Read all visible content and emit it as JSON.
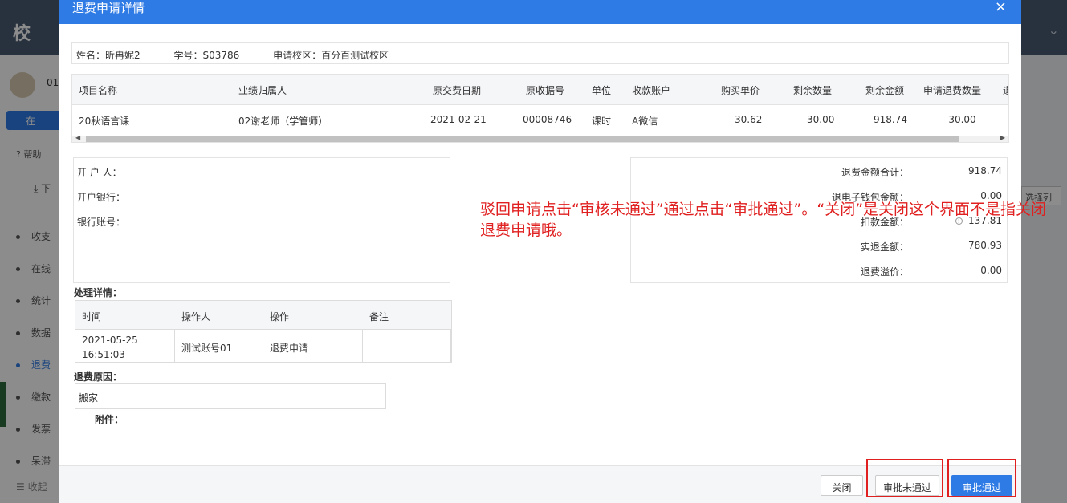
{
  "background": {
    "logo": "校",
    "user_label": "01",
    "pill_label": "在",
    "help_label": "帮助",
    "download_label": "下",
    "right_button": "选择列",
    "collapse_label": "收起",
    "menu": [
      {
        "label": "收支",
        "active": false
      },
      {
        "label": "在线",
        "active": false
      },
      {
        "label": "统计",
        "active": false
      },
      {
        "label": "数据",
        "active": false
      },
      {
        "label": "退费",
        "active": true
      },
      {
        "label": "缴款",
        "active": false
      },
      {
        "label": "发票",
        "active": false
      },
      {
        "label": "呆滞",
        "active": false
      }
    ]
  },
  "modal": {
    "title": "退费申请详情",
    "close_icon": "×",
    "student": {
      "name": "姓名：昕冉妮2",
      "student_id": "学号：S03786",
      "campus": "申请校区：百分百测试校区"
    },
    "items_table": {
      "headers": [
        "项目名称",
        "业绩归属人",
        "原交费日期",
        "原收据号",
        "单位",
        "收款账户",
        "购买单价",
        "剩余数量",
        "剩余金额",
        "申请退费数量",
        "退"
      ],
      "rows": [
        [
          "20秋语言课",
          "02谢老师（学管师）",
          "2021-02-21",
          "00008746",
          "课时",
          "A微信",
          "30.62",
          "30.00",
          "918.74",
          "-30.00",
          "-"
        ]
      ]
    },
    "bank": {
      "account_holder": "开 户 人：",
      "bank_name": "开户银行：",
      "account_number": "银行账号："
    },
    "summary": [
      {
        "label": "退费金额合计：",
        "value": "918.74",
        "icon": false
      },
      {
        "label": "退电子钱包金额：",
        "value": "0.00",
        "icon": false
      },
      {
        "label": "扣款金额：",
        "value": "-137.81",
        "icon": true
      },
      {
        "label": "实退金额：",
        "value": "780.93",
        "icon": false
      },
      {
        "label": "退费溢价：",
        "value": "0.00",
        "icon": false
      }
    ],
    "annotation": "驳回申请点击“审核未通过”通过点击“审批通过”。“关闭”是关闭这个界面不是指关闭退费申请哦。",
    "process": {
      "label": "处理详情：",
      "headers": [
        "时间",
        "操作人",
        "操作",
        "备注"
      ],
      "rows": [
        [
          "2021-05-25 16:51:03",
          "测试账号01",
          "退费申请",
          ""
        ]
      ]
    },
    "reason": {
      "label": "退费原因：",
      "value": "搬家"
    },
    "attachment_label": "附件：",
    "buttons": {
      "close": "关闭",
      "reject": "审批未通过",
      "approve": "审批通过"
    },
    "colors": {
      "primary": "#2f7be5",
      "annotation_red": "#e02020"
    }
  }
}
